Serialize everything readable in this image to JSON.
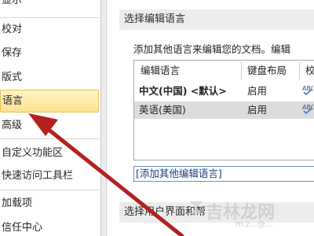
{
  "nav": {
    "items": [
      "显示",
      "校对",
      "保存",
      "版式",
      "语言",
      "高级",
      "自定义功能区",
      "快速访问工具栏",
      "加载项",
      "信任中心"
    ],
    "selected": "语言"
  },
  "sections": {
    "edit_language": {
      "title": "选择编辑语言",
      "description": "添加其他语言来编辑您的文档。编辑",
      "columns": [
        "编辑语言",
        "键盘布局",
        "校"
      ],
      "rows": [
        {
          "language": "中文(中国) <默认>",
          "keyboard": "启用"
        },
        {
          "language": "英语(美国)",
          "keyboard": "启用"
        }
      ],
      "add_language": "[添加其他编辑语言]"
    },
    "ui_language": {
      "title": "选择用户界面和帮"
    }
  },
  "watermark": {
    "text": "吉林龙网",
    "url": "m.z...@..."
  },
  "colors": {
    "selected_nav": "#fde38f",
    "arrow": "#b42020",
    "section_header": "#ececec"
  }
}
